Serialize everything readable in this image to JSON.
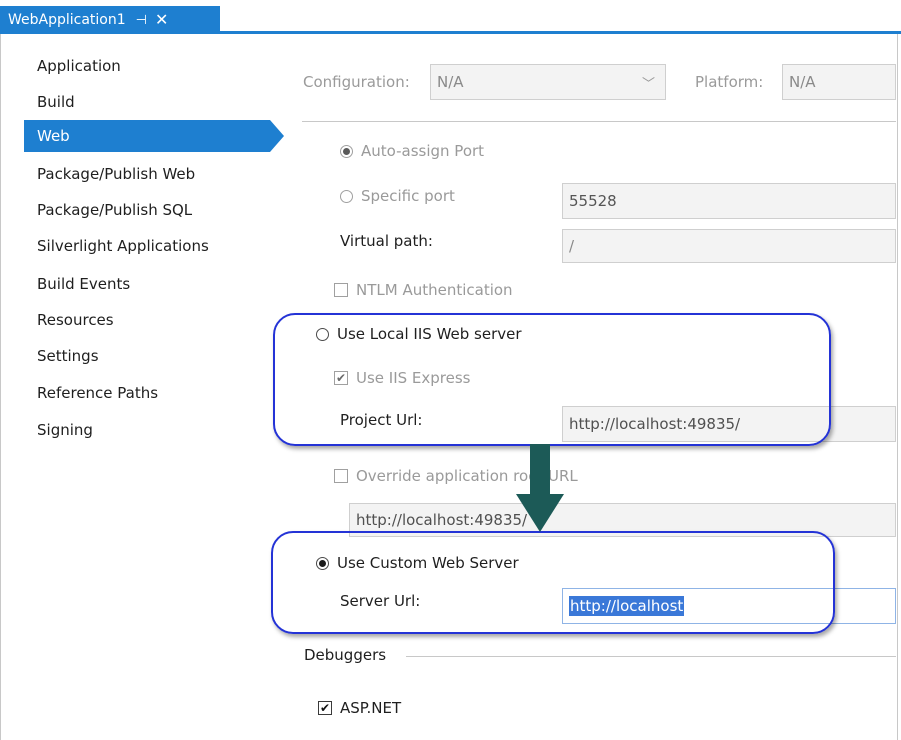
{
  "tab": {
    "title": "WebApplication1",
    "pin_icon": "pin-icon",
    "close_icon": "close-icon",
    "accent_color": "#1e7fd0"
  },
  "sidebar": {
    "items": [
      {
        "label": "Application"
      },
      {
        "label": "Build"
      },
      {
        "label": "Web"
      },
      {
        "label": "Package/Publish Web"
      },
      {
        "label": "Package/Publish SQL"
      },
      {
        "label": "Silverlight Applications"
      },
      {
        "label": "Build Events"
      },
      {
        "label": "Resources"
      },
      {
        "label": "Settings"
      },
      {
        "label": "Reference Paths"
      },
      {
        "label": "Signing"
      }
    ],
    "active_index": 2
  },
  "config": {
    "configuration_label": "Configuration:",
    "configuration_value": "N/A",
    "platform_label": "Platform:",
    "platform_value": "N/A",
    "dropdown_icon": "chevron-down-icon"
  },
  "servers": {
    "auto_assign_port": "Auto-assign Port",
    "specific_port": "Specific port",
    "specific_port_value": "55528",
    "virtual_path_label": "Virtual path:",
    "virtual_path_value": "/",
    "ntlm_auth": "NTLM Authentication",
    "use_local_iis": "Use Local IIS Web server",
    "use_iis_express": "Use IIS Express",
    "project_url_label": "Project Url:",
    "project_url_value": "http://localhost:49835/",
    "override_root_url": "Override application root URL",
    "override_root_url_value": "http://localhost:49835/",
    "use_custom_server": "Use Custom Web Server",
    "server_url_label": "Server Url:",
    "server_url_value": "http://localhost"
  },
  "debuggers": {
    "heading": "Debuggers",
    "aspnet": "ASP.NET"
  },
  "annotation": {
    "arrow_color": "#1c5a57",
    "box_color": "#2433d6"
  }
}
